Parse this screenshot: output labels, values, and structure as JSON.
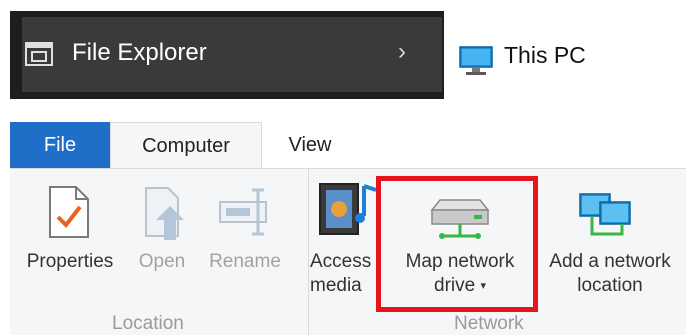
{
  "address_bar": {
    "location_label": "File Explorer",
    "chevron": "›",
    "current_label": "This PC"
  },
  "ribbon": {
    "tabs": [
      {
        "label": "File"
      },
      {
        "label": "Computer"
      },
      {
        "label": "View"
      }
    ],
    "groups": {
      "location": {
        "label": "Location",
        "commands": [
          {
            "label": "Properties",
            "icon": "properties-icon",
            "enabled": true
          },
          {
            "label": "Open",
            "icon": "open-icon",
            "enabled": false
          },
          {
            "label": "Rename",
            "icon": "rename-icon",
            "enabled": false
          }
        ]
      },
      "network": {
        "label": "Network",
        "commands": [
          {
            "label_line1": "Access",
            "label_line2": "media",
            "icon": "media-icon"
          },
          {
            "label_line1": "Map network",
            "label_line2": "drive",
            "icon": "network-drive-icon",
            "dropdown": "▾"
          },
          {
            "label_line1": "Add a network",
            "label_line2": "location",
            "icon": "network-location-icon"
          }
        ]
      }
    }
  },
  "colors": {
    "file_tab": "#1f6fc9",
    "highlight": "#e8141c",
    "dark_bar": "#1e1e1e"
  }
}
